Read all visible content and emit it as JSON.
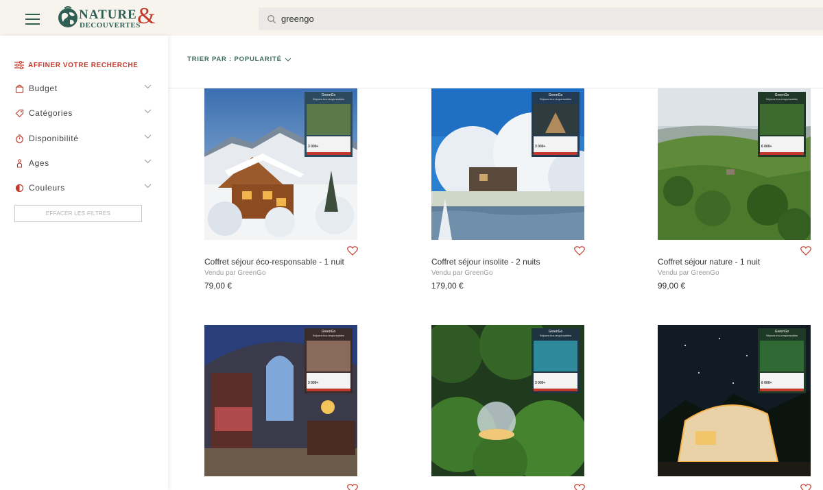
{
  "header": {
    "logo_word1": "NATURE",
    "logo_word2": "DECOUVERTES",
    "logo_amp": "&",
    "search_value": "greengo",
    "brand_green": "#2f5f54",
    "brand_red": "#c2392b"
  },
  "sidebar": {
    "refine_label": "AFFINER VOTRE RECHERCHE",
    "facets": [
      {
        "label": "Budget",
        "icon": "bag-icon"
      },
      {
        "label": "Catégories",
        "icon": "tag-icon"
      },
      {
        "label": "Disponibilité",
        "icon": "timer-icon"
      },
      {
        "label": "Ages",
        "icon": "person-icon"
      },
      {
        "label": "Couleurs",
        "icon": "half-circle-icon"
      }
    ],
    "clear_label": "EFFACER LES FILTRES"
  },
  "sort": {
    "label": "TRIER PAR : POPULARITÉ"
  },
  "products": [
    {
      "name": "Coffret séjour éco-responsable - 1 nuit",
      "seller": "Vendu par GreenGo",
      "price": "79,00 €",
      "box_title": "GreenGo",
      "box_subtitle": "Séjours éco-responsables",
      "box_count": "3 000+"
    },
    {
      "name": "Coffret séjour insolite - 2 nuits",
      "seller": "Vendu par GreenGo",
      "price": "179,00 €",
      "box_title": "GreenGo",
      "box_subtitle": "Séjours éco-responsables",
      "box_count": "3 000+"
    },
    {
      "name": "Coffret séjour nature - 1 nuit",
      "seller": "Vendu par GreenGo",
      "price": "99,00 €",
      "box_title": "GreenGo",
      "box_subtitle": "Séjours éco-responsables",
      "box_count": "6 000+"
    },
    {
      "name": "",
      "seller": "",
      "price": "",
      "box_title": "GreenGo",
      "box_subtitle": "Séjours éco-responsables",
      "box_count": "3 000+"
    },
    {
      "name": "",
      "seller": "",
      "price": "",
      "box_title": "GreenGo",
      "box_subtitle": "Séjours éco-responsables",
      "box_count": "3 000+"
    },
    {
      "name": "",
      "seller": "",
      "price": "",
      "box_title": "GreenGo",
      "box_subtitle": "Séjours éco-responsables",
      "box_count": "6 000+"
    }
  ]
}
